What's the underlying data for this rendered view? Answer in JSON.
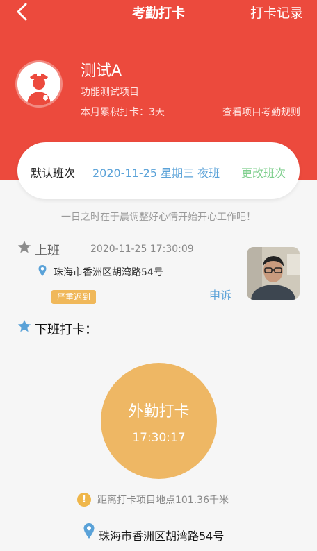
{
  "nav": {
    "title": "考勤打卡",
    "records": "打卡记录"
  },
  "profile": {
    "name": "测试A",
    "project": "功能测试项目",
    "month_stat": "本月累积打卡：3天",
    "rules_link": "查看项目考勤规则"
  },
  "shift": {
    "label": "默认班次",
    "value": "2020-11-25 星期三 夜班",
    "change": "更改班次"
  },
  "motto": "一日之时在于晨调整好心情开始开心工作吧！",
  "check_in": {
    "label": "上班",
    "time": "2020-11-25 17:30:09",
    "address": "珠海市香洲区胡湾路54号",
    "badge": "严重迟到",
    "appeal": "申诉"
  },
  "check_out": {
    "label": "下班打卡："
  },
  "punch": {
    "title": "外勤打卡",
    "time": "17:30:17"
  },
  "distance": "距离打卡项目地点101.36千米",
  "current_address": "珠海市香洲区胡湾路54号",
  "colors": {
    "header": "#ec4a3d",
    "accent_blue": "#5aa2d8",
    "accent_green": "#7fcf8e",
    "punch_button": "#eeb764",
    "badge": "#f0b85a"
  }
}
